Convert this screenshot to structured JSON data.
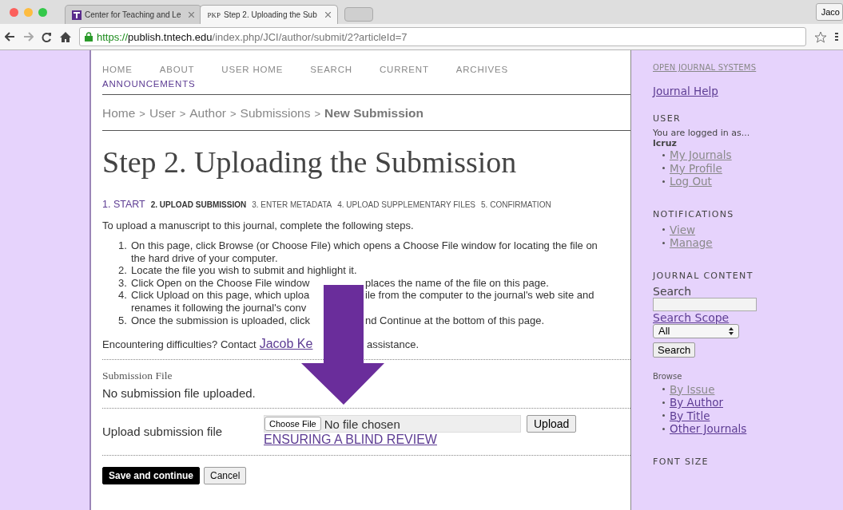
{
  "browser": {
    "tabs": [
      {
        "title": "Center for Teaching and Le",
        "selected": false
      },
      {
        "title": "Step 2. Uploading the Sub",
        "favicon_text": "PKP",
        "selected": true
      }
    ],
    "profile": "Jaco",
    "url": {
      "scheme": "https://",
      "host": "publish.tntech.edu",
      "path": "/index.php/JCI/author/submit/2?articleId=7"
    }
  },
  "nav": [
    {
      "label": "HOME",
      "visited": false
    },
    {
      "label": "ABOUT",
      "visited": false
    },
    {
      "label": "USER HOME",
      "visited": false
    },
    {
      "label": "SEARCH",
      "visited": false
    },
    {
      "label": "CURRENT",
      "visited": false
    },
    {
      "label": "ARCHIVES",
      "visited": false
    },
    {
      "label": "ANNOUNCEMENTS",
      "visited": true
    }
  ],
  "breadcrumb": {
    "items": [
      "Home",
      "User",
      "Author",
      "Submissions"
    ],
    "separator": ">",
    "current": "New Submission"
  },
  "title": "Step 2. Uploading the Submission",
  "steps": [
    {
      "label": "1. START",
      "kind": "link"
    },
    {
      "label": "2. UPLOAD SUBMISSION",
      "kind": "current"
    },
    {
      "label": "3. ENTER METADATA",
      "kind": "plain"
    },
    {
      "label": "4. UPLOAD SUPPLEMENTARY FILES",
      "kind": "plain"
    },
    {
      "label": "5. CONFIRMATION",
      "kind": "plain"
    }
  ],
  "intro": "To upload a manuscript to this journal, complete the following steps.",
  "instructions": [
    {
      "number": "1.",
      "lines": [
        [
          "On this page, click Browse (or Choose File) which opens a Choose File window for locating the file on the hard drive of your computer."
        ]
      ]
    },
    {
      "number": "2.",
      "lines": [
        [
          "Locate the file you wish to submit and highlight it."
        ]
      ]
    },
    {
      "number": "3.",
      "lines": [
        [
          "Click Open on the Choose File window",
          "places the name of the file on this page."
        ]
      ]
    },
    {
      "number": "4.",
      "lines": [
        [
          "Click Upload on this page, which uploa",
          "ile from the computer to the journal's web site and"
        ],
        [
          "renames it following the journal's conv"
        ]
      ]
    },
    {
      "number": "5.",
      "lines": [
        [
          "Once the submission is uploaded, click",
          "nd Continue at the bottom of this page."
        ]
      ]
    }
  ],
  "contact": {
    "before": "Encountering difficulties? Contact",
    "link": "Jacob Ke",
    "after": "assistance."
  },
  "submission_file": {
    "heading": "Submission File",
    "status": "No submission file uploaded."
  },
  "upload": {
    "label": "Upload submission file",
    "choose_button": "Choose File",
    "file_status": "No file chosen",
    "upload_button": "Upload",
    "link": "ENSURING A BLIND REVIEW"
  },
  "buttons": [
    {
      "label": "Save and continue",
      "kind": "primary"
    },
    {
      "label": "Cancel",
      "kind": "default"
    }
  ],
  "sidebar": {
    "ojs_link": "OPEN JOURNAL SYSTEMS",
    "help": {
      "label": "Journal Help",
      "visited": true
    },
    "user": {
      "heading": "USER",
      "logged_in": "You are logged in as...",
      "username": "lcruz",
      "links": [
        {
          "label": "My Journals",
          "visited": false
        },
        {
          "label": "My Profile",
          "visited": false
        },
        {
          "label": "Log Out",
          "visited": false
        }
      ]
    },
    "notifications": {
      "heading": "NOTIFICATIONS",
      "links": [
        {
          "label": "View",
          "visited": false
        },
        {
          "label": "Manage",
          "visited": false
        }
      ]
    },
    "journal_content": {
      "heading": "JOURNAL CONTENT",
      "search_label": "Search",
      "scope_label": "Search Scope",
      "scope_value": "All",
      "search_button": "Search",
      "browse_heading": "Browse",
      "browse_links": [
        {
          "label": "By Issue",
          "visited": false
        },
        {
          "label": "By Author",
          "visited": true
        },
        {
          "label": "By Title",
          "visited": true
        },
        {
          "label": "Other Journals",
          "visited": true
        }
      ]
    },
    "font_size_heading": "FONT SIZE"
  }
}
